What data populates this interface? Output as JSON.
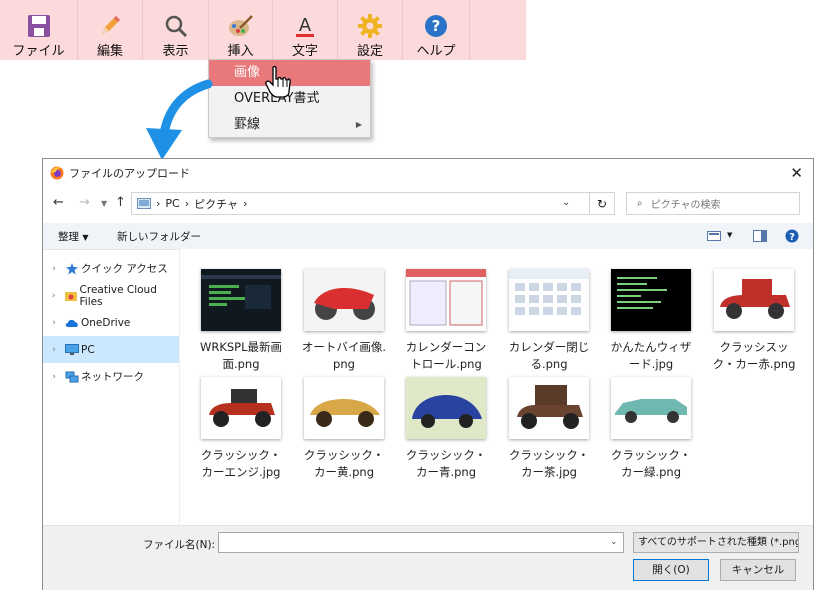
{
  "toolbar": {
    "items": [
      {
        "label": "ファイル",
        "icon": "floppy-disk-icon"
      },
      {
        "label": "編集",
        "icon": "pencil-icon"
      },
      {
        "label": "表示",
        "icon": "magnifier-icon"
      },
      {
        "label": "挿入",
        "icon": "paint-palette-icon"
      },
      {
        "label": "文字",
        "icon": "text-a-icon"
      },
      {
        "label": "設定",
        "icon": "gear-icon"
      },
      {
        "label": "ヘルプ",
        "icon": "help-icon"
      }
    ]
  },
  "menu": {
    "items": [
      {
        "label": "画像"
      },
      {
        "label": "OVERLAY書式"
      },
      {
        "label": "罫線"
      }
    ]
  },
  "dialog": {
    "title": "ファイルのアップロード",
    "address": {
      "root": "PC",
      "folder": "ピクチャ"
    },
    "search_placeholder": "ピクチャの検索",
    "command_bar": {
      "organize": "整理",
      "new_folder": "新しいフォルダー"
    },
    "sidebar": [
      {
        "label": "クイック アクセス",
        "icon": "star-icon"
      },
      {
        "label": "Creative Cloud Files",
        "icon": "creative-cloud-folder-icon"
      },
      {
        "label": "OneDrive",
        "icon": "cloud-icon"
      },
      {
        "label": "PC",
        "icon": "monitor-icon"
      },
      {
        "label": "ネットワーク",
        "icon": "network-icon"
      }
    ],
    "files": [
      {
        "name": "WRKSPL最新画面.png"
      },
      {
        "name": "オートバイ画像.png"
      },
      {
        "name": "カレンダーコントロール.png"
      },
      {
        "name": "カレンダー閉じる.png"
      },
      {
        "name": "かんたんウィザード.jpg"
      },
      {
        "name": "クラッシスック・カー赤.png"
      },
      {
        "name": "クラッシック・カーエンジ.jpg"
      },
      {
        "name": "クラッシック・カー黄.png"
      },
      {
        "name": "クラッシック・カー青.png"
      },
      {
        "name": "クラッシック・カー茶.jpg"
      },
      {
        "name": "クラッシック・カー緑.png"
      }
    ],
    "filename_label": "ファイル名(N):",
    "filename_value": "",
    "file_type": "すべてのサポートされた種類 (*.png;",
    "open_button": "開く(O)",
    "cancel_button": "キャンセル"
  },
  "colors": {
    "toolbar_bg": "#fcdadb",
    "menu_highlight": "#e8787a",
    "arrow": "#1e90e6",
    "selection": "#cce8ff"
  }
}
